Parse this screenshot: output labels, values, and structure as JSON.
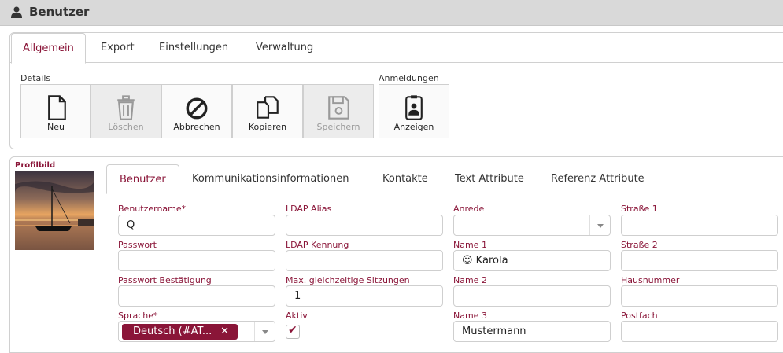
{
  "title": {
    "text": "Benutzer",
    "icon": "user-icon"
  },
  "top_tabs": [
    "Allgemein",
    "Export",
    "Einstellungen",
    "Verwaltung"
  ],
  "groups": {
    "details": "Details",
    "anmeldungen": "Anmeldungen"
  },
  "toolbar": [
    {
      "label": "Neu",
      "icon": "new-document-icon",
      "disabled": false
    },
    {
      "label": "Löschen",
      "icon": "trash-icon",
      "disabled": true
    },
    {
      "label": "Abbrechen",
      "icon": "cancel-icon",
      "disabled": false
    },
    {
      "label": "Kopieren",
      "icon": "copy-icon",
      "disabled": false
    },
    {
      "label": "Speichern",
      "icon": "save-icon",
      "disabled": true
    },
    {
      "label": "Anzeigen",
      "icon": "badge-icon",
      "disabled": false
    }
  ],
  "profile": {
    "label": "Profilbild"
  },
  "sub_tabs": [
    "Benutzer",
    "Kommunikationsinformationen",
    "Kontakte",
    "Text Attribute",
    "Referenz Attribute"
  ],
  "form": {
    "benutzername": {
      "label": "Benutzername",
      "value": "Q"
    },
    "passwort": {
      "label": "Passwort",
      "value": ""
    },
    "passwort_bestaetigung": {
      "label": "Passwort Bestätigung",
      "value": ""
    },
    "sprache": {
      "label": "Sprache",
      "value": "Deutsch (#AT...",
      "remove": "✕"
    },
    "ldap_alias": {
      "label": "LDAP Alias",
      "value": ""
    },
    "ldap_kennung": {
      "label": "LDAP Kennung",
      "value": ""
    },
    "max_sitzungen": {
      "label": "Max. gleichzeitige Sitzungen",
      "value": "1"
    },
    "aktiv": {
      "label": "Aktiv",
      "checked": true,
      "mark": "✔"
    },
    "anrede": {
      "label": "Anrede",
      "value": ""
    },
    "name1": {
      "label": "Name 1",
      "value": "☺ Karola"
    },
    "name2": {
      "label": "Name 2",
      "value": ""
    },
    "name3": {
      "label": "Name 3",
      "value": "Mustermann"
    },
    "strasse1": {
      "label": "Straße 1",
      "value": ""
    },
    "strasse2": {
      "label": "Straße 2",
      "value": ""
    },
    "hausnummer": {
      "label": "Hausnummer",
      "value": ""
    },
    "postfach": {
      "label": "Postfach",
      "value": ""
    }
  },
  "colors": {
    "accent": "#8a1538",
    "titlebar": "#d9d9d9"
  }
}
